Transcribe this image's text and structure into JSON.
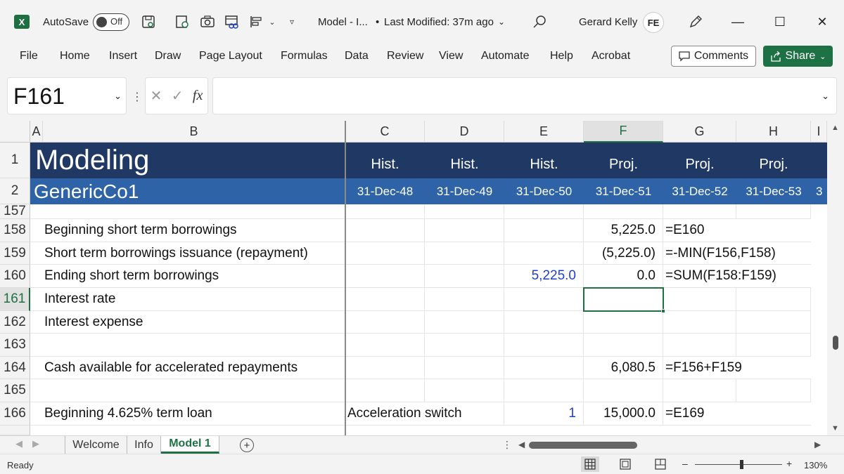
{
  "titlebar": {
    "app_icon": "excel-logo",
    "app_letter": "X",
    "autosave_label": "AutoSave",
    "autosave_state": "Off",
    "doc_title": "Model - I...",
    "bullet": "•",
    "last_modified": "Last Modified: 37m ago",
    "user_name": "Gerard Kelly",
    "user_initials": "FE",
    "win_min": "—",
    "win_max": "☐",
    "win_close": "✕"
  },
  "ribbon": {
    "tabs": [
      "File",
      "Home",
      "Insert",
      "Draw",
      "Page Layout",
      "Formulas",
      "Data",
      "Review",
      "View",
      "Automate",
      "Help",
      "Acrobat"
    ],
    "comments_label": "Comments",
    "share_label": "Share"
  },
  "formula_bar": {
    "name_box": "F161",
    "fx_label": "fx",
    "cancel_glyph": "✕",
    "enter_glyph": "✓",
    "formula": ""
  },
  "grid": {
    "columns": [
      "A",
      "B",
      "C",
      "D",
      "E",
      "F",
      "G",
      "H",
      "I"
    ],
    "selected_column": "F",
    "header_rows": {
      "row1_num": "1",
      "row2_num": "2",
      "title": "Modeling",
      "company": "GenericCo1",
      "periods": [
        {
          "label": "Hist.",
          "date": "31-Dec-48"
        },
        {
          "label": "Hist.",
          "date": "31-Dec-49"
        },
        {
          "label": "Hist.",
          "date": "31-Dec-50"
        },
        {
          "label": "Proj.",
          "date": "31-Dec-51"
        },
        {
          "label": "Proj.",
          "date": "31-Dec-52"
        },
        {
          "label": "Proj.",
          "date": "31-Dec-53"
        }
      ],
      "overflow_char": "3"
    },
    "rows": [
      {
        "num": "157",
        "b": "",
        "c": "",
        "e": "",
        "f": "",
        "g": ""
      },
      {
        "num": "158",
        "b": "Beginning short term borrowings",
        "c": "",
        "e": "",
        "f": "5,225.0",
        "g": "=E160"
      },
      {
        "num": "159",
        "b": "Short term borrowings issuance (repayment)",
        "c": "",
        "e": "",
        "f": "(5,225.0)",
        "g": "=-MIN(F156,F158)"
      },
      {
        "num": "160",
        "b": "Ending short term borrowings",
        "c": "",
        "e": "5,225.0",
        "f": "0.0",
        "g": "=SUM(F158:F159)"
      },
      {
        "num": "161",
        "b": "Interest rate",
        "c": "",
        "e": "",
        "f": "",
        "g": ""
      },
      {
        "num": "162",
        "b": "Interest expense",
        "c": "",
        "e": "",
        "f": "",
        "g": ""
      },
      {
        "num": "163",
        "b": "",
        "c": "",
        "e": "",
        "f": "",
        "g": ""
      },
      {
        "num": "164",
        "b": "Cash available for accelerated repayments",
        "c": "",
        "e": "",
        "f": "6,080.5",
        "g": "=F156+F159"
      },
      {
        "num": "165",
        "b": "",
        "c": "",
        "e": "",
        "f": "",
        "g": ""
      },
      {
        "num": "166",
        "b": "Beginning 4.625% term loan",
        "c": "Acceleration switch",
        "e": "1",
        "f": "15,000.0",
        "g": "=E169"
      }
    ],
    "selected_row": "161"
  },
  "sheets": {
    "tabs": [
      "Welcome",
      "Info",
      "Model 1"
    ],
    "active": "Model 1",
    "add_glyph": "+"
  },
  "status": {
    "text": "Ready",
    "zoom_minus": "–",
    "zoom_plus": "+",
    "zoom": "130%"
  },
  "colors": {
    "accent": "#1e7145",
    "header_dark": "#1f3864",
    "header_mid": "#2e64a7",
    "input_blue": "#1f3fd1"
  }
}
